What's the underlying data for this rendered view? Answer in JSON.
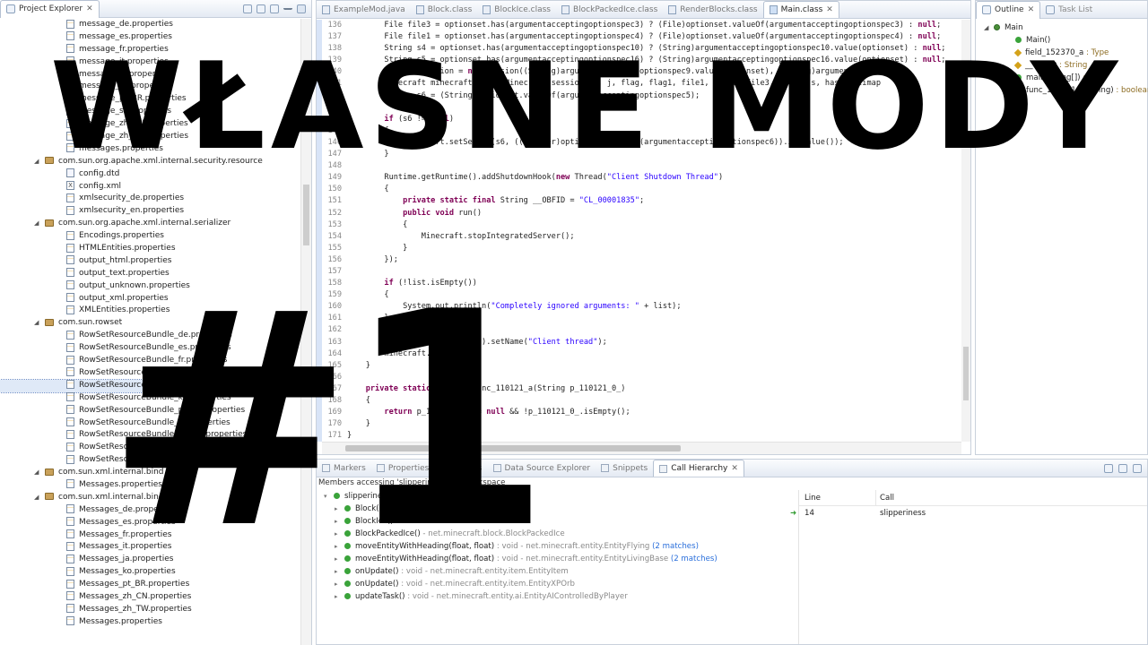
{
  "explorer": {
    "tab_label": "Project Explorer",
    "rows": [
      {
        "label": "message_de.properties",
        "kind": "props",
        "depth": 2
      },
      {
        "label": "message_es.properties",
        "kind": "props",
        "depth": 2
      },
      {
        "label": "message_fr.properties",
        "kind": "props",
        "depth": 2
      },
      {
        "label": "message_it.properties",
        "kind": "props",
        "depth": 2
      },
      {
        "label": "message_ja.properties",
        "kind": "props",
        "depth": 2
      },
      {
        "label": "message_ko.properties",
        "kind": "props",
        "depth": 2
      },
      {
        "label": "message_pt_BR.properties",
        "kind": "props",
        "depth": 2
      },
      {
        "label": "message_sv.properties",
        "kind": "props",
        "depth": 2
      },
      {
        "label": "message_zh_CN.properties",
        "kind": "props",
        "depth": 2
      },
      {
        "label": "message_zh_TW.properties",
        "kind": "props",
        "depth": 2
      },
      {
        "label": "messages.properties",
        "kind": "props",
        "depth": 2
      },
      {
        "label": "com.sun.org.apache.xml.internal.security.resource",
        "kind": "pkg",
        "depth": 1
      },
      {
        "label": "config.dtd",
        "kind": "dtd",
        "depth": 2
      },
      {
        "label": "config.xml",
        "kind": "xml",
        "depth": 2
      },
      {
        "label": "xmlsecurity_de.properties",
        "kind": "props",
        "depth": 2
      },
      {
        "label": "xmlsecurity_en.properties",
        "kind": "props",
        "depth": 2
      },
      {
        "label": "com.sun.org.apache.xml.internal.serializer",
        "kind": "pkg",
        "depth": 1
      },
      {
        "label": "Encodings.properties",
        "kind": "props",
        "depth": 2
      },
      {
        "label": "HTMLEntities.properties",
        "kind": "props",
        "depth": 2
      },
      {
        "label": "output_html.properties",
        "kind": "props",
        "depth": 2
      },
      {
        "label": "output_text.properties",
        "kind": "props",
        "depth": 2
      },
      {
        "label": "output_unknown.properties",
        "kind": "props",
        "depth": 2
      },
      {
        "label": "output_xml.properties",
        "kind": "props",
        "depth": 2
      },
      {
        "label": "XMLEntities.properties",
        "kind": "props",
        "depth": 2
      },
      {
        "label": "com.sun.rowset",
        "kind": "pkg",
        "depth": 1
      },
      {
        "label": "RowSetResourceBundle_de.properties",
        "kind": "props",
        "depth": 2
      },
      {
        "label": "RowSetResourceBundle_es.properties",
        "kind": "props",
        "depth": 2
      },
      {
        "label": "RowSetResourceBundle_fr.properties",
        "kind": "props",
        "depth": 2
      },
      {
        "label": "RowSetResourceBundle_it.properties",
        "kind": "props",
        "depth": 2
      },
      {
        "label": "RowSetResourceBundle_ja.properties",
        "kind": "props",
        "depth": 2,
        "selected": true
      },
      {
        "label": "RowSetResourceBundle_ko.properties",
        "kind": "props",
        "depth": 2
      },
      {
        "label": "RowSetResourceBundle_pt_BR.properties",
        "kind": "props",
        "depth": 2
      },
      {
        "label": "RowSetResourceBundle_sv.properties",
        "kind": "props",
        "depth": 2
      },
      {
        "label": "RowSetResourceBundle_zh_CN.properties",
        "kind": "props",
        "depth": 2
      },
      {
        "label": "RowSetResourceBundle_zh_TW.properties",
        "kind": "props",
        "depth": 2
      },
      {
        "label": "RowSetResourceBundle.properties",
        "kind": "props",
        "depth": 2
      },
      {
        "label": "com.sun.xml.internal.bind",
        "kind": "pkg",
        "depth": 1
      },
      {
        "label": "Messages.properties",
        "kind": "props",
        "depth": 2
      },
      {
        "label": "com.sun.xml.internal.bind.v2",
        "kind": "pkg",
        "depth": 1
      },
      {
        "label": "Messages_de.properties",
        "kind": "props",
        "depth": 2
      },
      {
        "label": "Messages_es.properties",
        "kind": "props",
        "depth": 2
      },
      {
        "label": "Messages_fr.properties",
        "kind": "props",
        "depth": 2
      },
      {
        "label": "Messages_it.properties",
        "kind": "props",
        "depth": 2
      },
      {
        "label": "Messages_ja.properties",
        "kind": "props",
        "depth": 2
      },
      {
        "label": "Messages_ko.properties",
        "kind": "props",
        "depth": 2
      },
      {
        "label": "Messages_pt_BR.properties",
        "kind": "props",
        "depth": 2
      },
      {
        "label": "Messages_zh_CN.properties",
        "kind": "props",
        "depth": 2
      },
      {
        "label": "Messages_zh_TW.properties",
        "kind": "props",
        "depth": 2
      },
      {
        "label": "Messages.properties",
        "kind": "props",
        "depth": 2
      }
    ]
  },
  "editor": {
    "tabs": [
      {
        "label": "ExampleMod.java",
        "active": false
      },
      {
        "label": "Block.class",
        "active": false
      },
      {
        "label": "BlockIce.class",
        "active": false
      },
      {
        "label": "BlockPackedIce.class",
        "active": false
      },
      {
        "label": "RenderBlocks.class",
        "active": false
      },
      {
        "label": "Main.class",
        "active": true
      }
    ],
    "lines": [
      {
        "n": "136",
        "t": "        File file3 = optionset.has(argumentacceptingoptionspec3) ? (File)optionset.valueOf(argumentacceptingoptionspec3) : null;"
      },
      {
        "n": "137",
        "t": "        File file1 = optionset.has(argumentacceptingoptionspec4) ? (File)optionset.valueOf(argumentacceptingoptionspec4) : null;"
      },
      {
        "n": "138",
        "t": "        String s4 = optionset.has(argumentacceptingoptionspec10) ? (String)argumentacceptingoptionspec10.value(optionset) : null;"
      },
      {
        "n": "139",
        "t": "        String s5 = optionset.has(argumentacceptingoptionspec16) ? (String)argumentacceptingoptionspec16.value(optionset) : null;"
      },
      {
        "n": "140",
        "t": "        Session session = new Session((String)argumentacceptingoptionspec9.value(optionset), (String)argumentacc"
      },
      {
        "n": "141",
        "t": "        Minecraft minecraft = new Minecraft(session, i, j, flag, flag1, file1, file2, file3, proxy, s, hashmultimap"
      },
      {
        "n": "142",
        "t": "        String s6 = (String)optionset.valueOf(argumentacceptingoptionspec5);"
      },
      {
        "n": "143",
        "t": ""
      },
      {
        "n": "144",
        "t": "        if (s6 != null)"
      },
      {
        "n": "145",
        "t": "        {"
      },
      {
        "n": "146",
        "t": "            minecraft.setServer(s6, ((Integer)optionset.valueOf(argumentacceptingoptionspec6)).intValue());"
      },
      {
        "n": "147",
        "t": "        }"
      },
      {
        "n": "148",
        "t": ""
      },
      {
        "n": "149",
        "t": "        Runtime.getRuntime().addShutdownHook(new Thread(\"Client Shutdown Thread\")"
      },
      {
        "n": "150",
        "t": "        {"
      },
      {
        "n": "151",
        "t": "            private static final String __OBFID = \"CL_00001835\";"
      },
      {
        "n": "152",
        "t": "            public void run()"
      },
      {
        "n": "153",
        "t": "            {"
      },
      {
        "n": "154",
        "t": "                Minecraft.stopIntegratedServer();"
      },
      {
        "n": "155",
        "t": "            }"
      },
      {
        "n": "156",
        "t": "        });"
      },
      {
        "n": "157",
        "t": ""
      },
      {
        "n": "158",
        "t": "        if (!list.isEmpty())"
      },
      {
        "n": "159",
        "t": "        {"
      },
      {
        "n": "160",
        "t": "            System.out.println(\"Completely ignored arguments: \" + list);"
      },
      {
        "n": "161",
        "t": "        }"
      },
      {
        "n": "162",
        "t": ""
      },
      {
        "n": "163",
        "t": "        Thread.currentThread().setName(\"Client thread\");"
      },
      {
        "n": "164",
        "t": "        minecraft.run();"
      },
      {
        "n": "165",
        "t": "    }"
      },
      {
        "n": "166",
        "t": ""
      },
      {
        "n": "167",
        "t": "    private static boolean func_110121_a(String p_110121_0_)"
      },
      {
        "n": "168",
        "t": "    {"
      },
      {
        "n": "169",
        "t": "        return p_110121_0_ != null && !p_110121_0_.isEmpty();"
      },
      {
        "n": "170",
        "t": "    }"
      },
      {
        "n": "171",
        "t": "}"
      }
    ]
  },
  "outline": {
    "tabs": [
      {
        "label": "Outline",
        "active": true
      },
      {
        "label": "Task List",
        "active": false
      }
    ],
    "items": [
      {
        "label": "Main",
        "type": "",
        "kind": "class",
        "depth": 0
      },
      {
        "label": "Main()",
        "type": "",
        "kind": "green",
        "depth": 1
      },
      {
        "label": "field_152370_a",
        "type": " : Type",
        "kind": "yellow",
        "depth": 1
      },
      {
        "label": "__OBFID",
        "type": " : String",
        "kind": "yellow",
        "depth": 1
      },
      {
        "label": "main(String[])",
        "type": " : void",
        "kind": "green",
        "depth": 1
      },
      {
        "label": "func_110121_a(String)",
        "type": " : boolean",
        "kind": "red",
        "depth": 1
      }
    ]
  },
  "bottom": {
    "tabs": [
      {
        "label": "Markers",
        "active": false
      },
      {
        "label": "Properties",
        "active": false
      },
      {
        "label": "Servers",
        "active": false
      },
      {
        "label": "Data Source Explorer",
        "active": false
      },
      {
        "label": "Snippets",
        "active": false
      },
      {
        "label": "Call Hierarchy",
        "active": true
      }
    ],
    "title": "Members accessing 'slipperiness' - in workspace",
    "tree": [
      {
        "name": "slipperiness",
        "rest": " - net.minecraft.block.Block",
        "match": "",
        "depth": 0,
        "expanded": true
      },
      {
        "name": "Block(Material)",
        "rest": " - net.minecraft.block.Block",
        "match": "",
        "depth": 1
      },
      {
        "name": "BlockIce()",
        "rest": " - net.minecraft.block.BlockIce",
        "match": "",
        "depth": 1
      },
      {
        "name": "BlockPackedIce()",
        "rest": " - net.minecraft.block.BlockPackedIce",
        "match": "",
        "depth": 1
      },
      {
        "name": "moveEntityWithHeading(float, float)",
        "rest": " : void - net.minecraft.entity.EntityFlying",
        "match": " (2 matches)",
        "depth": 1
      },
      {
        "name": "moveEntityWithHeading(float, float)",
        "rest": " : void - net.minecraft.entity.EntityLivingBase",
        "match": " (2 matches)",
        "depth": 1
      },
      {
        "name": "onUpdate()",
        "rest": " : void - net.minecraft.entity.item.EntityItem",
        "match": "",
        "depth": 1
      },
      {
        "name": "onUpdate()",
        "rest": " : void - net.minecraft.entity.item.EntityXPOrb",
        "match": "",
        "depth": 1
      },
      {
        "name": "updateTask()",
        "rest": " : void - net.minecraft.entity.ai.EntityAIControlledByPlayer",
        "match": "",
        "depth": 1
      }
    ],
    "table": {
      "col_line": "Line",
      "col_call": "Call",
      "rows": [
        {
          "line": "14",
          "call": "slipperiness"
        }
      ]
    }
  },
  "overlay": {
    "title": "WŁASNE MODY",
    "number": "#1"
  }
}
